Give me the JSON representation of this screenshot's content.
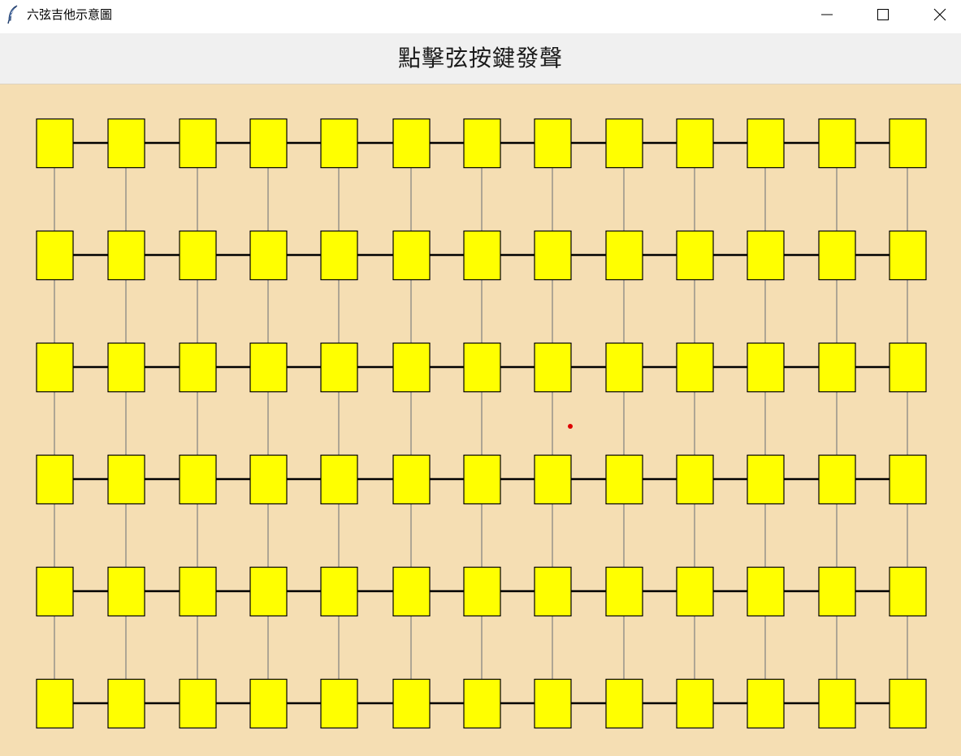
{
  "window": {
    "title": "六弦吉他示意圖",
    "icon": "feather-icon",
    "controls": [
      "minimize-icon",
      "maximize-icon",
      "close-icon"
    ]
  },
  "header": {
    "label": "點擊弦按鍵發聲"
  },
  "fretboard": {
    "strings": 6,
    "frets": 13,
    "background_color": "#f5deb3",
    "key_color": "#ffff00",
    "key_border_color": "#000000",
    "string_color": "#000000",
    "vertical_line_color": "#808080",
    "marker_color": "#dd0000"
  }
}
